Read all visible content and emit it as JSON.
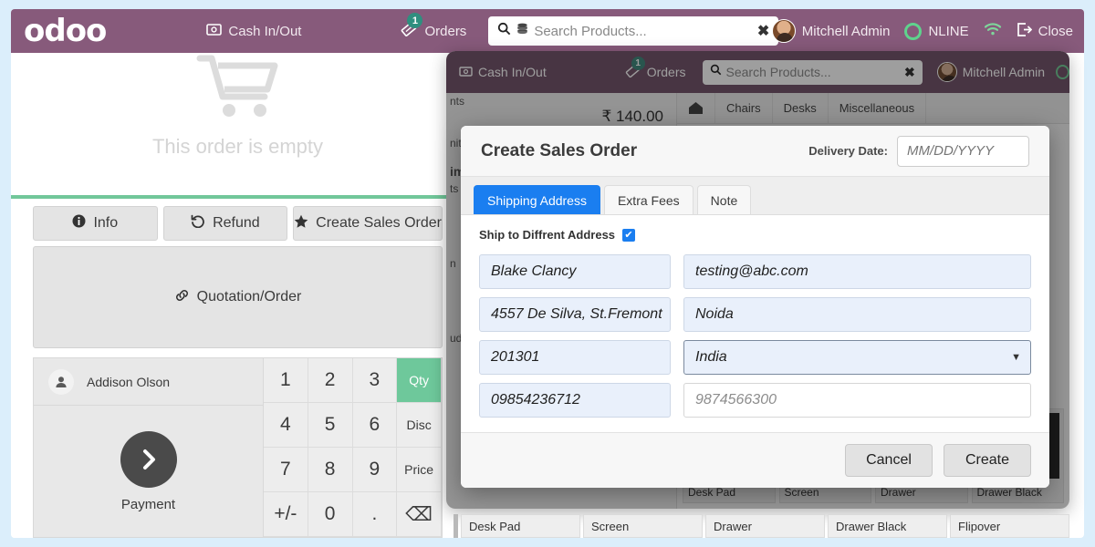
{
  "header": {
    "logo": "odoo",
    "cash_in_out": "Cash In/Out",
    "cash_icon": "banknote-icon",
    "orders": "Orders",
    "orders_icon": "ticket-icon",
    "orders_badge": "1",
    "search_placeholder": "Search Products...",
    "search_icon": "search-icon",
    "search_clear": "✖",
    "user": "Mitchell Admin",
    "status": "NLINE",
    "wifi_icon": "wifi-icon",
    "close": "Close",
    "close_icon": "logout-icon",
    "bg_color": "#875A7B"
  },
  "order_panel": {
    "empty_text": "This order is empty",
    "cart_icon": "shopping-cart-icon",
    "divider_color": "#71c79a",
    "buttons": [
      {
        "label": "Info",
        "icon": "info-icon"
      },
      {
        "label": "Refund",
        "icon": "undo-icon"
      },
      {
        "label": "Create Sales Order",
        "icon": "star-icon"
      }
    ],
    "wide_button": {
      "label": "Quotation/Order",
      "icon": "link-icon"
    },
    "customer": "Addison Olson",
    "customer_icon": "person-icon",
    "payment_label": "Payment",
    "payment_icon": "chevron-right-icon",
    "numpad": [
      "1",
      "2",
      "3",
      "Qty",
      "4",
      "5",
      "6",
      "Disc",
      "7",
      "8",
      "9",
      "Price",
      "+/-",
      "0",
      ".",
      "⌫"
    ],
    "numpad_active": "Qty",
    "active_color": "#6EC89B"
  },
  "background_window": {
    "cash_in_out": "Cash In/Out",
    "orders": "Orders",
    "orders_badge": "1",
    "search_placeholder": "Search Products...",
    "search_clear": "✖",
    "user": "Mitchell Admin",
    "total": "₹ 140.00",
    "fragments": [
      "nts",
      "nits",
      "im",
      "ts",
      "n",
      "ud"
    ],
    "home_icon": "home-icon",
    "categories": [
      "Chairs",
      "Desks",
      "Miscellaneous"
    ],
    "products": [
      "Desk Pad",
      "Desk Stand with Screen",
      "Drawer",
      "Drawer Black"
    ],
    "bottom_products": [
      "Desk Pad",
      "Screen",
      "Drawer",
      "Drawer Black",
      "Flipover"
    ]
  },
  "modal": {
    "title": "Create Sales Order",
    "delivery_date_label": "Delivery Date:",
    "delivery_date_placeholder": "MM/DD/YYYY",
    "delivery_date_value": "",
    "tabs": [
      {
        "label": "Shipping Address",
        "active": true
      },
      {
        "label": "Extra Fees",
        "active": false
      },
      {
        "label": "Note",
        "active": false
      }
    ],
    "ship_diff_label": "Ship to Diffrent Address",
    "ship_diff_checked": true,
    "check_glyph": "✔",
    "accent_color": "#1a7ef0",
    "fields": {
      "name": "Blake Clancy",
      "email": "testing@abc.com",
      "street": "4557 De Silva, St.Fremont",
      "city": "Noida",
      "zip": "201301",
      "country": "India",
      "phone": "09854236712",
      "mobile_placeholder": "9874566300"
    },
    "cancel_label": "Cancel",
    "create_label": "Create"
  }
}
